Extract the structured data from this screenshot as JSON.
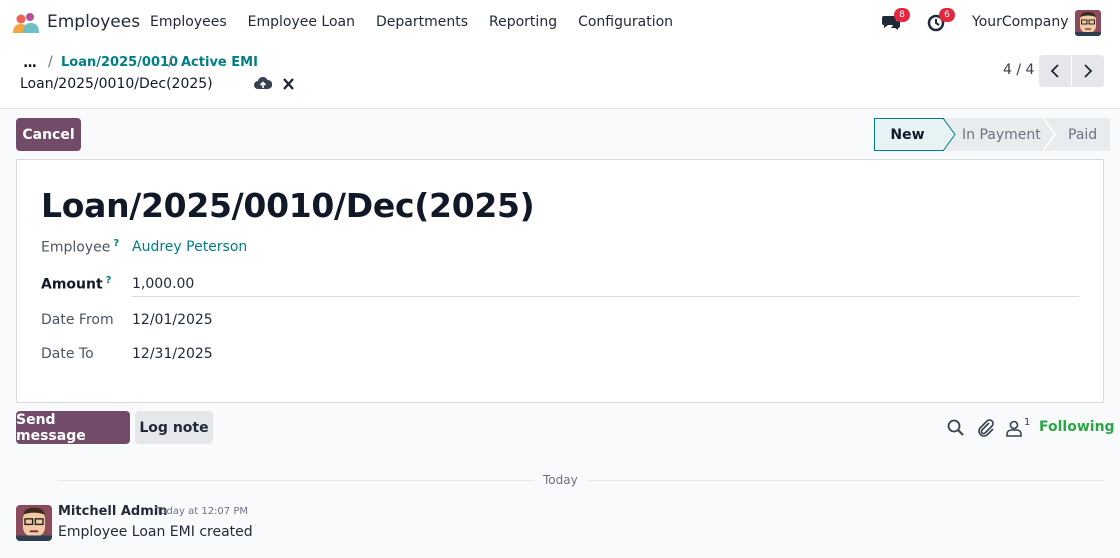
{
  "navbar": {
    "app_name": "Employees",
    "menu": [
      "Employees",
      "Employee Loan",
      "Departments",
      "Reporting",
      "Configuration"
    ],
    "messages_badge": "8",
    "activities_badge": "6",
    "company": "YourCompany",
    "icons": [
      "app-logo-icon",
      "chat-icon",
      "clock-icon",
      "user-avatar"
    ]
  },
  "breadcrumb": {
    "more": "...",
    "items": [
      "Loan/2025/0010",
      "Active EMI"
    ],
    "current": "Loan/2025/0010/Dec(2025)"
  },
  "pager": {
    "value": "4 / 4"
  },
  "actions": {
    "cancel": "Cancel"
  },
  "statusbar": {
    "stages": [
      "New",
      "In Payment",
      "Paid"
    ],
    "active": "New"
  },
  "form": {
    "title": "Loan/2025/0010/Dec(2025)",
    "fields": [
      {
        "label": "Employee",
        "help": "?",
        "value": "Audrey Peterson"
      },
      {
        "label": "Amount",
        "help": "?",
        "value": "1,000.00"
      },
      {
        "label": "Date From",
        "value": "12/01/2025"
      },
      {
        "label": "Date To",
        "value": "12/31/2025"
      }
    ]
  },
  "chatter": {
    "send_message": "Send message",
    "log_note": "Log note",
    "followers_count": "1",
    "following": "Following",
    "date_separator": "Today",
    "messages": [
      {
        "author": "Mitchell Admin",
        "time": "Today at 12:07 PM",
        "body": "Employee Loan EMI created"
      }
    ]
  },
  "colors": {
    "primary": "#714b67",
    "link": "#017e84",
    "following": "#28a745",
    "badge": "#e5263f"
  }
}
